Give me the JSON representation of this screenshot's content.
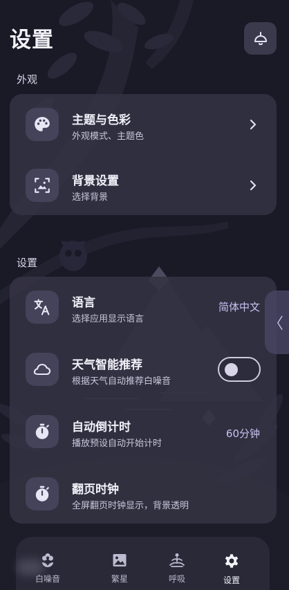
{
  "header": {
    "title": "设置",
    "top_button_icon": "lamp-icon"
  },
  "sections": {
    "appearance_label": "外观",
    "settings_label": "设置"
  },
  "appearance": [
    {
      "icon": "palette-icon",
      "title": "主题与色彩",
      "subtitle": "外观模式、主题色"
    },
    {
      "icon": "image-frame-icon",
      "title": "背景设置",
      "subtitle": "选择背景"
    }
  ],
  "settings": {
    "language": {
      "icon": "translate-icon",
      "title": "语言",
      "subtitle": "选择应用显示语言",
      "value": "简体中文"
    },
    "weather": {
      "icon": "cloud-icon",
      "title": "天气智能推荐",
      "subtitle": "根据天气自动推荐白噪音",
      "enabled": false
    },
    "countdown": {
      "icon": "stopwatch-icon",
      "title": "自动倒计时",
      "subtitle": "播放预设自动开始计时",
      "value": "60分钟"
    },
    "flip_clock": {
      "icon": "stopwatch-icon",
      "title": "翻页时钟",
      "subtitle": "全屏翻页时钟显示，背景透明"
    }
  },
  "side_handle": {
    "glyph": "〈"
  },
  "tabs": [
    {
      "icon": "flower-icon",
      "label": "白噪音",
      "active": false
    },
    {
      "icon": "landscape-image-icon",
      "label": "繁星",
      "active": false
    },
    {
      "icon": "meditation-icon",
      "label": "呼吸",
      "active": false
    },
    {
      "icon": "gear-icon",
      "label": "设置",
      "active": true
    }
  ],
  "colors": {
    "background": "#1a1926",
    "card": "#343344",
    "accent_value": "#c7c3f2"
  }
}
